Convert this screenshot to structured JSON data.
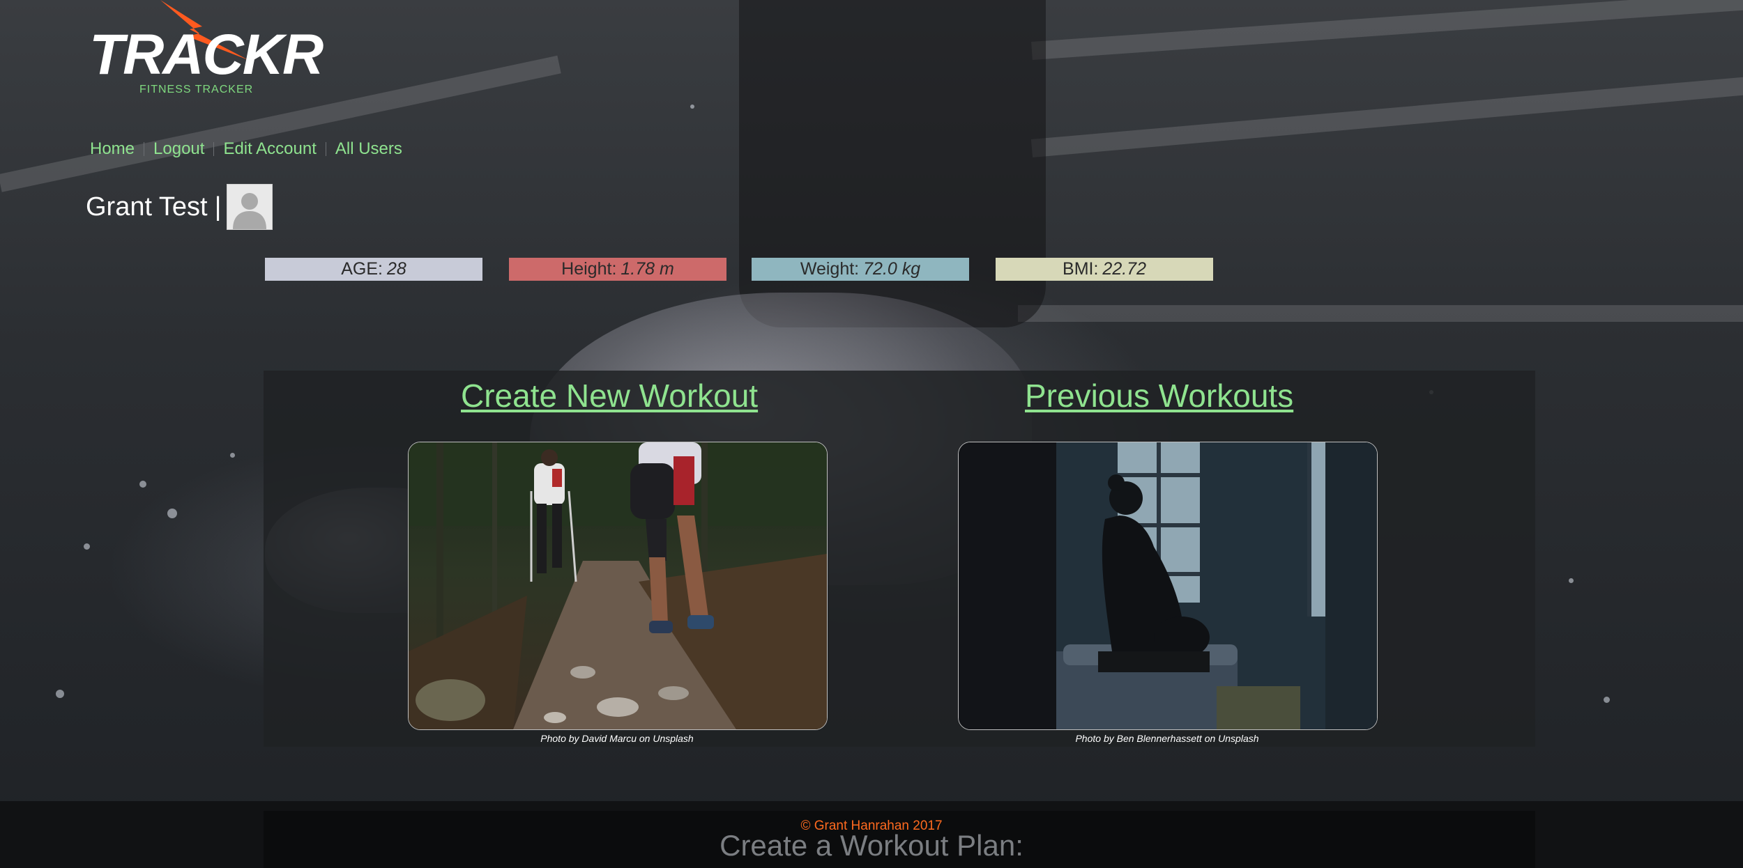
{
  "brand": {
    "logo_text": "TRACKR",
    "tagline": "FITNESS TRACKER"
  },
  "nav": {
    "items": [
      {
        "label": "Home"
      },
      {
        "label": "Logout"
      },
      {
        "label": "Edit Account"
      },
      {
        "label": "All Users"
      }
    ]
  },
  "user": {
    "name": "Grant Test",
    "separator": "|",
    "avatar_icon": "default-user-avatar-icon"
  },
  "stats": {
    "age": {
      "label": "AGE:",
      "value": "28",
      "color": "#c8cbd8"
    },
    "height": {
      "label": "Height:",
      "value": "1.78 m",
      "color": "#cd6a6a"
    },
    "weight": {
      "label": "Weight:",
      "value": "72.0 kg",
      "color": "#8fb6bf"
    },
    "bmi": {
      "label": "BMI:",
      "value": "22.72",
      "color": "#d7d8b8"
    }
  },
  "workouts": {
    "create": {
      "label": "Create New Workout",
      "photo_credit": "Photo by David Marcu on Unsplash"
    },
    "previous": {
      "label": "Previous Workouts",
      "photo_credit": "Photo by Ben Blennerhassett on Unsplash"
    }
  },
  "footer": {
    "copyright": "© Grant Hanrahan 2017",
    "plan_heading": "Create a Workout Plan:"
  },
  "colors": {
    "link_green": "#8fe38f",
    "accent_orange": "#ff6a1f"
  }
}
